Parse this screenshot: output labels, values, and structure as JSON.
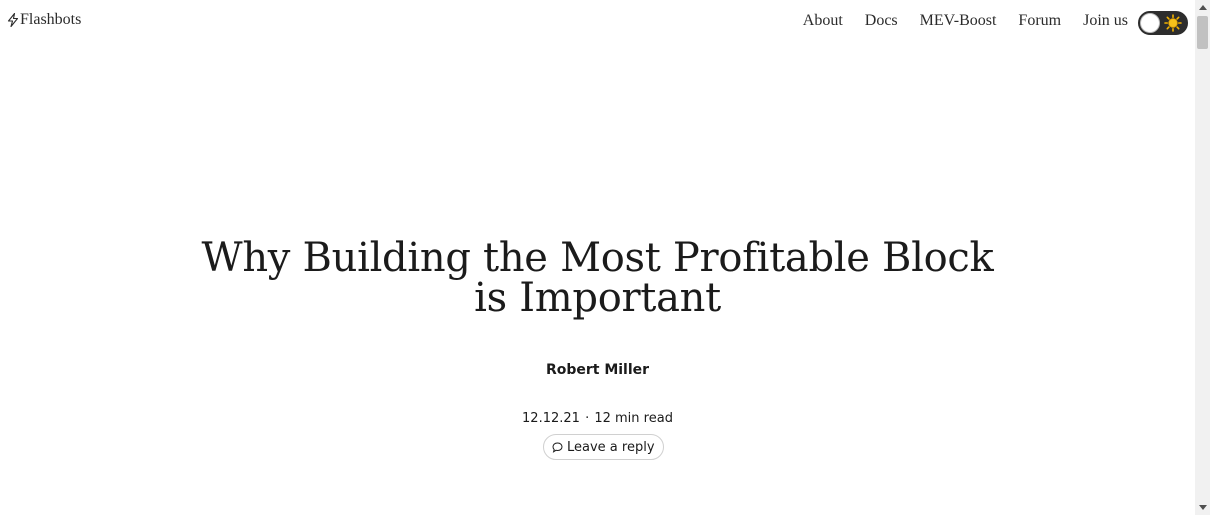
{
  "header": {
    "brand": {
      "name": "Flashbots",
      "icon": "lightning-icon"
    },
    "nav": [
      {
        "label": "About"
      },
      {
        "label": "Docs"
      },
      {
        "label": "MEV-Boost"
      },
      {
        "label": "Forum"
      },
      {
        "label": "Join us"
      }
    ],
    "theme_toggle": {
      "state": "light",
      "icon": "sun-icon"
    }
  },
  "article": {
    "title_line1": "Why Building the Most Profitable Block",
    "title_line2": "is Important",
    "author": "Robert Miller",
    "date": "12.12.21",
    "separator": "·",
    "read_time": "12 min read",
    "reply_label": "Leave a reply",
    "reply_icon": "comment-icon"
  },
  "colors": {
    "text": "#1b1b1b",
    "toggle_bg": "#2d2d2d",
    "sun": "#f5b400"
  }
}
